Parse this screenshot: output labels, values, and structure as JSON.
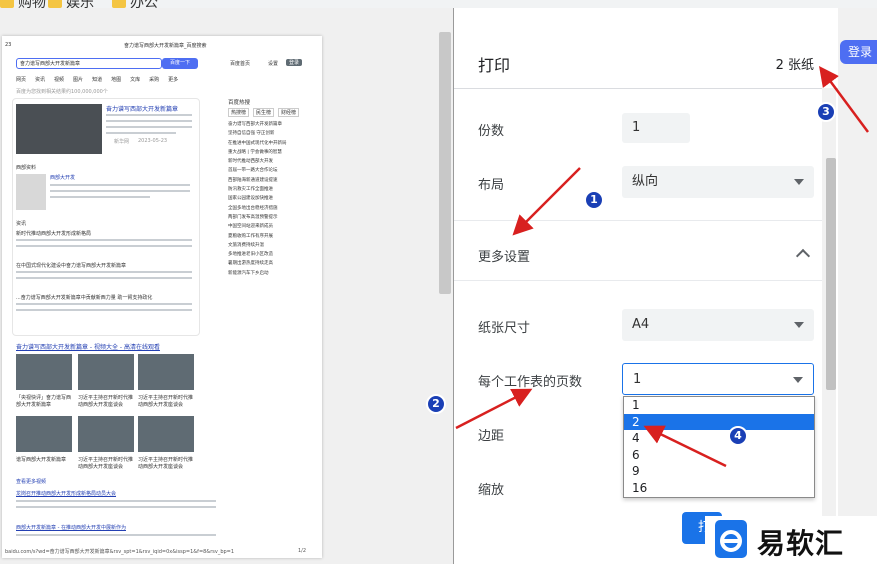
{
  "bookmarks": [
    "购物",
    "娱乐",
    "办公"
  ],
  "preview": {
    "page_header_left": "23",
    "page_header_center": "奋力谱写西部大开发新篇章_百度搜索",
    "search_query": "奋力谱写西部大开发新篇章",
    "search_button": "百度一下",
    "top_links": [
      "百度首页",
      "设置",
      "登录"
    ],
    "tabs": [
      "网页",
      "资讯",
      "视频",
      "图片",
      "知道",
      "地图",
      "文库",
      "采购",
      "更多"
    ],
    "result_count": "百度为您找到相关结果约100,000,000个",
    "card_title": "奋力谱写西部大开发新篇章",
    "card_source": "新华网",
    "card_date": "2023-05-23",
    "baike_label": "西部资料",
    "baike_title": "西部大开发",
    "news_label": "资讯",
    "news_title_1": "新时代推动西部大开发形成新格局",
    "news_title_2": "在中国式现代化建设中奋力谱写西部大开发新篇章",
    "news_title_3": "...奋力谱写西部大开发新篇章中贡献新西力量 助一臂支持政化",
    "video_section_title": "奋力谱写西部大开发新篇章 - 视频大全 - 高清在线观看",
    "video_caption_1": "「央视快评」奋力谱写西部大开发新篇章",
    "video_caption_2": "习近平主持召开新时代推动西部大开发座谈会",
    "video_caption_3": "习近平主持召开新时代推动西部大开发座谈会",
    "video_caption_4": "谱写西部大开发新篇章",
    "video_caption_5": "习近平主持召开新时代推动西部大开发座谈会",
    "video_caption_6": "习近平主持召开新时代推动西部大开发座谈会",
    "more_videos": "查看更多视频",
    "result_title_4": "龙岗召开推动西部大开发形成新格局动员大会",
    "result_title_5": "西部大开发新篇章 - 在推动西部大开发中展新作为",
    "hot_title": "百度热搜",
    "hot_tabs": [
      "热搜榜",
      "民生榜",
      "财经榜"
    ],
    "hot_items": [
      "奋力谱写西部大开发新篇章",
      "坚持自信自强 守正创新",
      "在推进中国式现代化中开新局",
      "重大战略 | 学会做事的智慧",
      "新时代推动西部大开发",
      "首届一带一路大合作论坛",
      "西部陆海新通道建设提速",
      "防汛救灾工作全面推进",
      "国家公园建设加快推进",
      "全国多地出台稳经济措施",
      "两部门发布高温预警提示",
      "中国空间站迎来新成员",
      "夏粮收购工作有序开展",
      "文旅消费持续升温",
      "多地推进老旧小区改造",
      "暑期出游热度持续走高",
      "新能源汽车下乡启动"
    ],
    "footer_url": "baidu.com/s?wd=奋力谱写西部大开发新篇章&rsv_spt=1&rsv_iqid=0x&issp=1&f=8&rsv_bp=1",
    "footer_page": "1/2"
  },
  "settings": {
    "title": "打印",
    "sheets": "2 张纸",
    "copies_label": "份数",
    "copies_value": "1",
    "layout_label": "布局",
    "layout_value": "纵向",
    "more_settings_label": "更多设置",
    "paper_size_label": "纸张尺寸",
    "paper_size_value": "A4",
    "pages_per_sheet_label": "每个工作表的页数",
    "pages_per_sheet_value": "1",
    "margins_label": "边距",
    "scale_label": "缩放",
    "pages_per_sheet_options": [
      "1",
      "2",
      "4",
      "6",
      "9",
      "16"
    ],
    "highlighted_option": "2",
    "print_button": "打"
  },
  "login_button": "登录",
  "annotations": [
    "1",
    "2",
    "3",
    "4"
  ],
  "watermark_text": "易软汇",
  "colors": {
    "accent": "#1a73e8",
    "arrow": "#d8201f",
    "badge": "#1a3fb5"
  }
}
